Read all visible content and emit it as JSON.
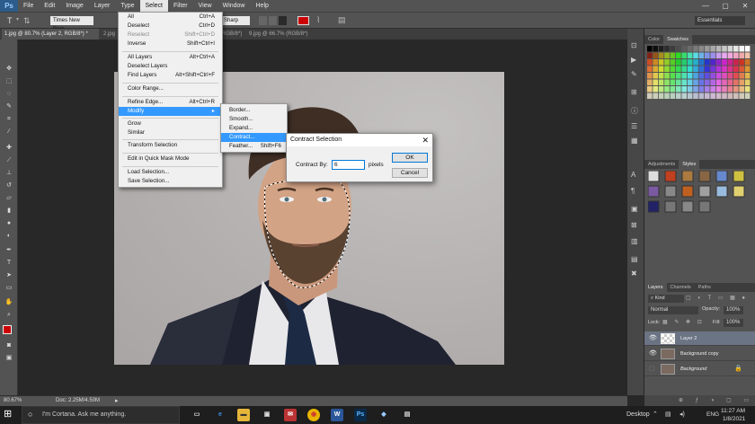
{
  "app": {
    "logo": "Ps"
  },
  "menubar": [
    "File",
    "Edit",
    "Image",
    "Layer",
    "Type",
    "Select",
    "Filter",
    "View",
    "Window",
    "Help"
  ],
  "window_controls": [
    "—",
    "▢",
    "✕"
  ],
  "options": {
    "font": "Times New Rom...",
    "antialias": "Sharp",
    "workspace": "Essentials"
  },
  "tabs": [
    "1.jpg @ 80.7% (Layer 2, RGB/8*) *",
    "2.jpg",
    "(RGB/8*)",
    "9.jpg @ 66.7% (RGB/8*)"
  ],
  "status": {
    "zoom": "80.67%",
    "doc": "Doc: 2.25M/4.50M"
  },
  "select_menu": [
    {
      "label": "All",
      "shortcut": "Ctrl+A"
    },
    {
      "label": "Deselect",
      "shortcut": "Ctrl+D"
    },
    {
      "label": "Reselect",
      "shortcut": "Shift+Ctrl+D",
      "disabled": true
    },
    {
      "label": "Inverse",
      "shortcut": "Shift+Ctrl+I"
    },
    {
      "label": "All Layers",
      "shortcut": "Alt+Ctrl+A"
    },
    {
      "label": "Deselect Layers",
      "shortcut": ""
    },
    {
      "label": "Find Layers",
      "shortcut": "Alt+Shift+Ctrl+F"
    },
    {
      "label": "Color Range...",
      "shortcut": ""
    },
    {
      "label": "Refine Edge...",
      "shortcut": "Alt+Ctrl+R"
    },
    {
      "label": "Modify",
      "shortcut": ""
    },
    {
      "label": "Grow",
      "shortcut": ""
    },
    {
      "label": "Similar",
      "shortcut": ""
    },
    {
      "label": "Transform Selection",
      "shortcut": ""
    },
    {
      "label": "Edit in Quick Mask Mode",
      "shortcut": ""
    },
    {
      "label": "Load Selection...",
      "shortcut": ""
    },
    {
      "label": "Save Selection...",
      "shortcut": ""
    }
  ],
  "modify_menu": [
    {
      "label": "Border...",
      "shortcut": ""
    },
    {
      "label": "Smooth...",
      "shortcut": ""
    },
    {
      "label": "Expand...",
      "shortcut": ""
    },
    {
      "label": "Contract...",
      "shortcut": ""
    },
    {
      "label": "Feather...",
      "shortcut": "Shift+F6"
    }
  ],
  "dialog": {
    "title": "Contract Selection",
    "label": "Contract By:",
    "value": "6",
    "unit": "pixels",
    "ok": "OK",
    "cancel": "Cancel"
  },
  "panels": {
    "color_tabs": [
      "Color",
      "Swatches"
    ],
    "adj_tabs": [
      "Adjustments",
      "Styles"
    ],
    "layer_tabs": [
      "Layers",
      "Channels",
      "Paths"
    ],
    "kind": "Kind",
    "blend": "Normal",
    "opacity_label": "Opacity:",
    "opacity": "100%",
    "lock_label": "Lock:",
    "fill_label": "Fill:",
    "fill": "100%",
    "layers": [
      "Layer 2",
      "Background copy",
      "Background"
    ]
  },
  "taskbar": {
    "search": "I'm Cortana. Ask me anything.",
    "desktop": "Desktop",
    "lang": "ENG",
    "time": "11:27 AM",
    "date": "1/8/2021"
  },
  "colors": {
    "selection_highlight": "#3399ff",
    "foreground": "#cc0000",
    "layer_selected": "#6b7484"
  }
}
